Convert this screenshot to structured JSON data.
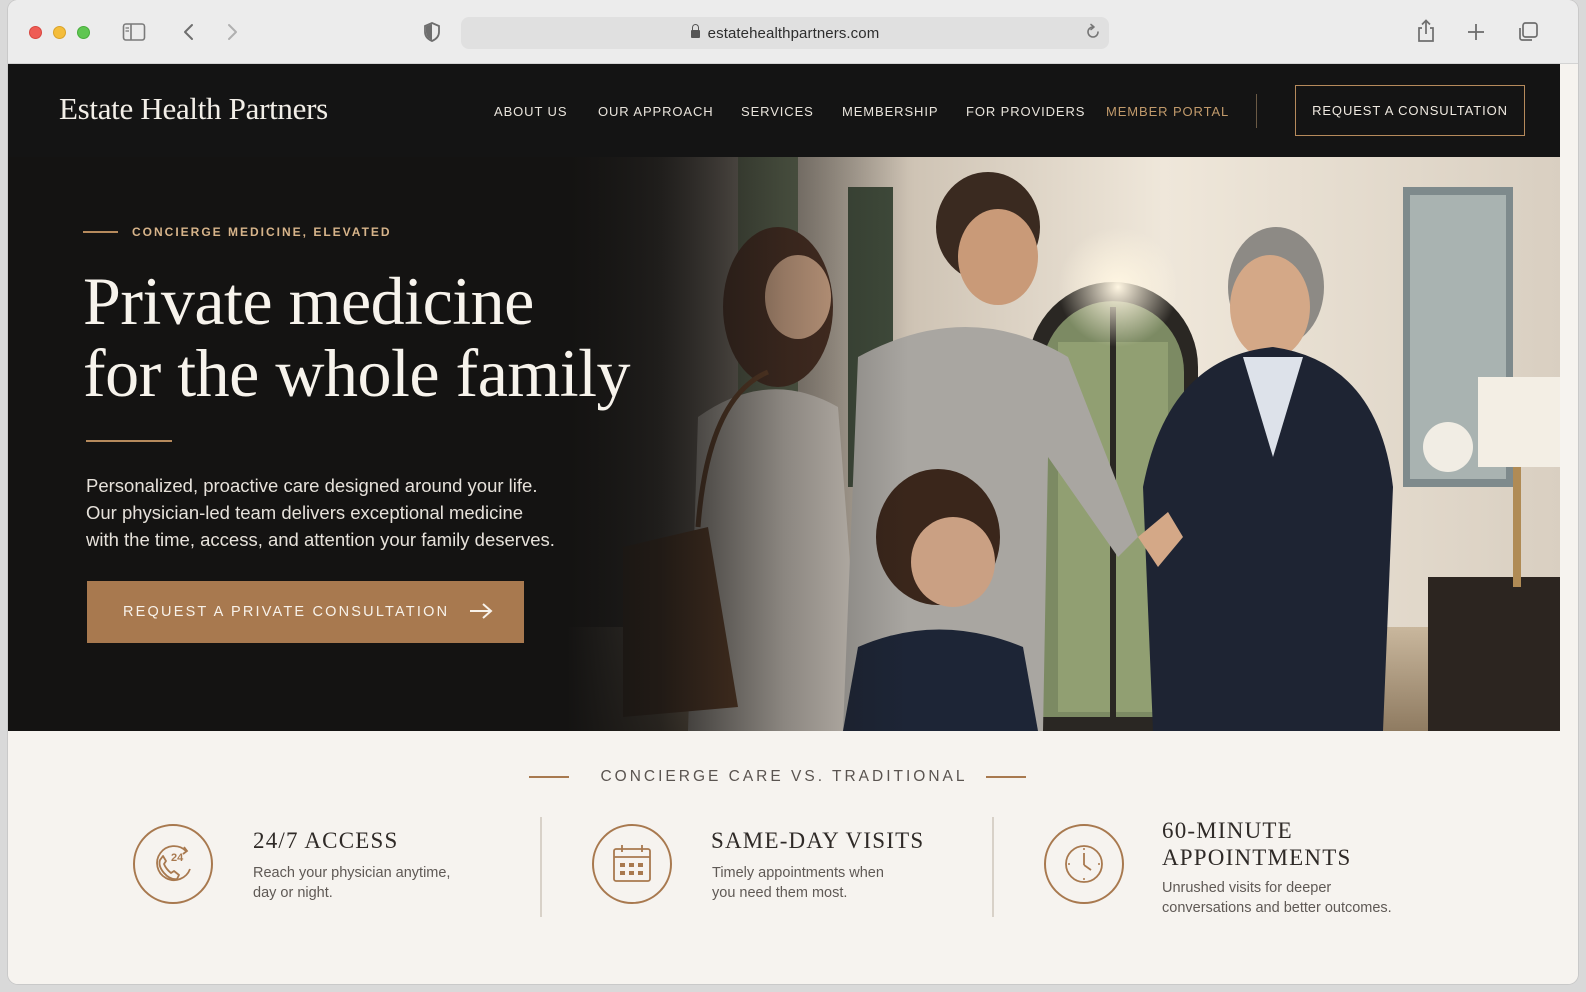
{
  "browser": {
    "url": "estatehealthpartners.com"
  },
  "header": {
    "logo": "Estate Health Partners",
    "nav": [
      "ABOUT US",
      "OUR APPROACH",
      "SERVICES",
      "MEMBERSHIP",
      "FOR PROVIDERS",
      "MEMBER PORTAL"
    ],
    "cta": "REQUEST A CONSULTATION"
  },
  "hero": {
    "eyebrow": "CONCIERGE MEDICINE, ELEVATED",
    "title_line1": "Private medicine",
    "title_line2": "for the whole family",
    "body_line1": "Personalized, proactive care designed around your life.",
    "body_line2": "Our physician-led team delivers exceptional medicine",
    "body_line3": "with the time, access, and attention your family deserves.",
    "cta": "REQUEST A PRIVATE CONSULTATION"
  },
  "features": {
    "section_title": "CONCIERGE CARE VS. TRADITIONAL",
    "items": [
      {
        "icon": "phone-24-icon",
        "badge": "24",
        "title": "24/7 ACCESS",
        "desc_line1": "Reach your physician anytime,",
        "desc_line2": "day or night."
      },
      {
        "icon": "calendar-icon",
        "title": "SAME-DAY VISITS",
        "desc_line1": "Timely appointments when",
        "desc_line2": "you need them most."
      },
      {
        "icon": "clock-icon",
        "title_line1": "60-MINUTE",
        "title_line2": "APPOINTMENTS",
        "desc_line1": "Unrushed visits for deeper",
        "desc_line2": "conversations and better outcomes."
      }
    ]
  },
  "colors": {
    "header_bg": "#141414",
    "accent": "#a8794f",
    "portal_link": "#c19a6b",
    "page_bg": "#f6f3ef"
  }
}
